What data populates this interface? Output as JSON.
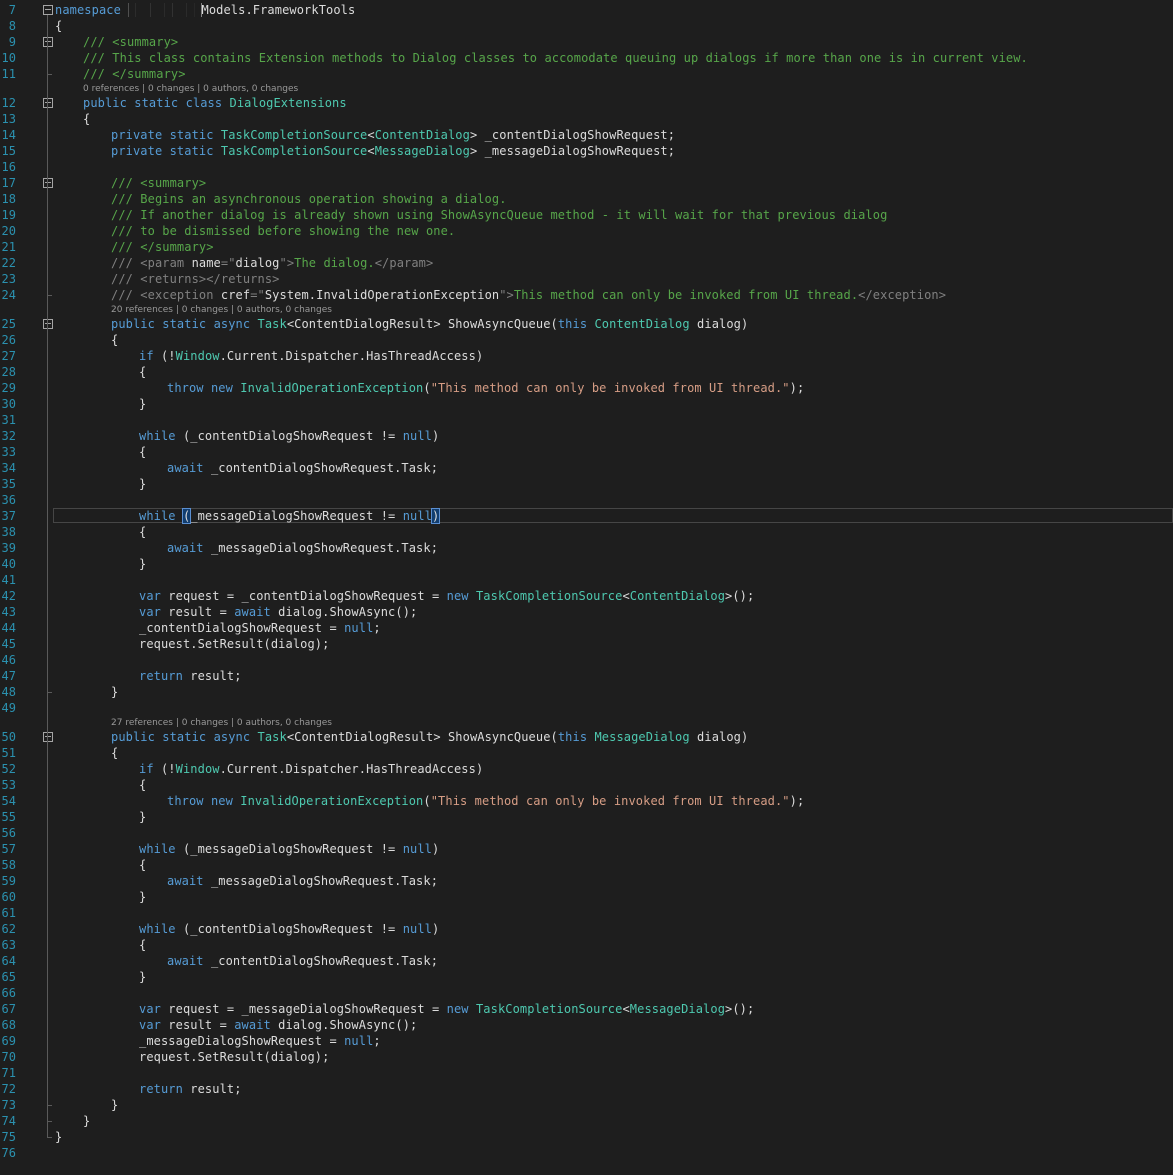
{
  "editor": {
    "theme": {
      "background": "#1e1e1e",
      "line_number_color": "#2b91af",
      "keyword_color": "#569cd6",
      "type_color": "#4ec9b0",
      "comment_color": "#57a64a",
      "string_color": "#d69d85",
      "text_color": "#dcdcdc"
    },
    "lines": [
      {
        "n": "7",
        "fold": true,
        "indent": 0,
        "tokens": [
          [
            "kw",
            "namespace"
          ],
          [
            "pl",
            " "
          ],
          [
            "red",
            "██████████"
          ],
          [
            "pl",
            "Models.FrameworkTools"
          ]
        ]
      },
      {
        "n": "8",
        "indent": 0,
        "tokens": [
          [
            "pl",
            "{"
          ]
        ]
      },
      {
        "n": "9",
        "fold": true,
        "indent": 1,
        "tokens": [
          [
            "cm",
            "/// <summary>"
          ]
        ]
      },
      {
        "n": "10",
        "indent": 1,
        "tokens": [
          [
            "cm",
            "/// This class contains Extension methods to Dialog classes to accomodate queuing up dialogs if more than one is in current view."
          ]
        ]
      },
      {
        "n": "11",
        "indent": 1,
        "tokens": [
          [
            "cm",
            "/// </summary>"
          ]
        ]
      },
      {
        "n": "12",
        "fold": true,
        "lens": "0 references | 0 changes | 0 authors, 0 changes",
        "indent": 1,
        "tokens": [
          [
            "kw",
            "public"
          ],
          [
            "pl",
            " "
          ],
          [
            "kw",
            "static"
          ],
          [
            "pl",
            " "
          ],
          [
            "kw",
            "class"
          ],
          [
            "pl",
            " "
          ],
          [
            "type",
            "DialogExtensions"
          ]
        ]
      },
      {
        "n": "13",
        "indent": 1,
        "tokens": [
          [
            "pl",
            "{"
          ]
        ]
      },
      {
        "n": "14",
        "indent": 2,
        "tokens": [
          [
            "kw",
            "private"
          ],
          [
            "pl",
            " "
          ],
          [
            "kw",
            "static"
          ],
          [
            "pl",
            " "
          ],
          [
            "type",
            "TaskCompletionSource"
          ],
          [
            "pl",
            "<"
          ],
          [
            "type",
            "ContentDialog"
          ],
          [
            "pl",
            "> _contentDialogShowRequest;"
          ]
        ]
      },
      {
        "n": "15",
        "indent": 2,
        "tokens": [
          [
            "kw",
            "private"
          ],
          [
            "pl",
            " "
          ],
          [
            "kw",
            "static"
          ],
          [
            "pl",
            " "
          ],
          [
            "type",
            "TaskCompletionSource"
          ],
          [
            "pl",
            "<"
          ],
          [
            "type",
            "MessageDialog"
          ],
          [
            "pl",
            "> _messageDialogShowRequest;"
          ]
        ]
      },
      {
        "n": "16",
        "indent": 0,
        "tokens": []
      },
      {
        "n": "17",
        "fold": true,
        "indent": 2,
        "tokens": [
          [
            "cm",
            "/// <summary>"
          ]
        ]
      },
      {
        "n": "18",
        "indent": 2,
        "tokens": [
          [
            "cm",
            "/// Begins an asynchronous operation showing a dialog."
          ]
        ]
      },
      {
        "n": "19",
        "indent": 2,
        "tokens": [
          [
            "cm",
            "/// If another dialog is already shown using ShowAsyncQueue method - it will wait for that previous dialog"
          ]
        ]
      },
      {
        "n": "20",
        "indent": 2,
        "tokens": [
          [
            "cm",
            "/// to be dismissed before showing the new one."
          ]
        ]
      },
      {
        "n": "21",
        "indent": 2,
        "tokens": [
          [
            "cm",
            "/// </summary>"
          ]
        ]
      },
      {
        "n": "22",
        "indent": 2,
        "tokens": [
          [
            "xml",
            "/// <param "
          ],
          [
            "pl",
            "name"
          ],
          [
            "xml",
            "=\""
          ],
          [
            "pl",
            "dialog"
          ],
          [
            "xml",
            "\">"
          ],
          [
            "cm",
            "The dialog."
          ],
          [
            "xml",
            "</param>"
          ]
        ]
      },
      {
        "n": "23",
        "indent": 2,
        "tokens": [
          [
            "xml",
            "/// <returns></returns>"
          ]
        ]
      },
      {
        "n": "24",
        "indent": 2,
        "tokens": [
          [
            "xml",
            "/// <exception "
          ],
          [
            "pl",
            "cref"
          ],
          [
            "xml",
            "=\""
          ],
          [
            "pl",
            "System.InvalidOperationException"
          ],
          [
            "xml",
            "\">"
          ],
          [
            "cm",
            "This method can only be invoked from UI thread."
          ],
          [
            "xml",
            "</exception>"
          ]
        ]
      },
      {
        "n": "25",
        "fold": true,
        "lens": "20 references | 0 changes | 0 authors, 0 changes",
        "indent": 2,
        "tokens": [
          [
            "kw",
            "public"
          ],
          [
            "pl",
            " "
          ],
          [
            "kw",
            "static"
          ],
          [
            "pl",
            " "
          ],
          [
            "kw",
            "async"
          ],
          [
            "pl",
            " "
          ],
          [
            "type",
            "Task"
          ],
          [
            "pl",
            "<ContentDialogResult> ShowAsyncQueue("
          ],
          [
            "kw",
            "this"
          ],
          [
            "pl",
            " "
          ],
          [
            "type",
            "ContentDialog"
          ],
          [
            "pl",
            " dialog)"
          ]
        ]
      },
      {
        "n": "26",
        "indent": 2,
        "tokens": [
          [
            "pl",
            "{"
          ]
        ]
      },
      {
        "n": "27",
        "indent": 3,
        "tokens": [
          [
            "kw",
            "if"
          ],
          [
            "pl",
            " (!"
          ],
          [
            "type",
            "Window"
          ],
          [
            "pl",
            ".Current.Dispatcher.HasThreadAccess)"
          ]
        ]
      },
      {
        "n": "28",
        "indent": 3,
        "tokens": [
          [
            "pl",
            "{"
          ]
        ]
      },
      {
        "n": "29",
        "indent": 4,
        "tokens": [
          [
            "kw",
            "throw"
          ],
          [
            "pl",
            " "
          ],
          [
            "kw",
            "new"
          ],
          [
            "pl",
            " "
          ],
          [
            "type",
            "InvalidOperationException"
          ],
          [
            "pl",
            "("
          ],
          [
            "str",
            "\"This method can only be invoked from UI thread.\""
          ],
          [
            "pl",
            ");"
          ]
        ]
      },
      {
        "n": "30",
        "indent": 3,
        "tokens": [
          [
            "pl",
            "}"
          ]
        ]
      },
      {
        "n": "31",
        "indent": 0,
        "tokens": []
      },
      {
        "n": "32",
        "indent": 3,
        "tokens": [
          [
            "kw",
            "while"
          ],
          [
            "pl",
            " (_contentDialogShowRequest != "
          ],
          [
            "kw",
            "null"
          ],
          [
            "pl",
            ")"
          ]
        ]
      },
      {
        "n": "33",
        "indent": 3,
        "tokens": [
          [
            "pl",
            "{"
          ]
        ]
      },
      {
        "n": "34",
        "indent": 4,
        "tokens": [
          [
            "kw",
            "await"
          ],
          [
            "pl",
            " _contentDialogShowRequest.Task;"
          ]
        ]
      },
      {
        "n": "35",
        "indent": 3,
        "tokens": [
          [
            "pl",
            "}"
          ]
        ]
      },
      {
        "n": "36",
        "indent": 0,
        "tokens": []
      },
      {
        "n": "37",
        "current": true,
        "indent": 3,
        "tokens": [
          [
            "kw",
            "while"
          ],
          [
            "pl",
            " "
          ],
          [
            "brk",
            "("
          ],
          [
            "pl",
            "_messageDialogShowRequest != "
          ],
          [
            "kw",
            "null"
          ],
          [
            "brk",
            ")"
          ]
        ]
      },
      {
        "n": "38",
        "indent": 3,
        "tokens": [
          [
            "pl",
            "{"
          ]
        ]
      },
      {
        "n": "39",
        "indent": 4,
        "tokens": [
          [
            "kw",
            "await"
          ],
          [
            "pl",
            " _messageDialogShowRequest.Task;"
          ]
        ]
      },
      {
        "n": "40",
        "indent": 3,
        "tokens": [
          [
            "pl",
            "}"
          ]
        ]
      },
      {
        "n": "41",
        "indent": 0,
        "tokens": []
      },
      {
        "n": "42",
        "indent": 3,
        "tokens": [
          [
            "kw",
            "var"
          ],
          [
            "pl",
            " request = _contentDialogShowRequest = "
          ],
          [
            "kw",
            "new"
          ],
          [
            "pl",
            " "
          ],
          [
            "type",
            "TaskCompletionSource"
          ],
          [
            "pl",
            "<"
          ],
          [
            "type",
            "ContentDialog"
          ],
          [
            "pl",
            ">();"
          ]
        ]
      },
      {
        "n": "43",
        "indent": 3,
        "tokens": [
          [
            "kw",
            "var"
          ],
          [
            "pl",
            " result = "
          ],
          [
            "kw",
            "await"
          ],
          [
            "pl",
            " dialog.ShowAsync();"
          ]
        ]
      },
      {
        "n": "44",
        "indent": 3,
        "tokens": [
          [
            "pl",
            "_contentDialogShowRequest = "
          ],
          [
            "kw",
            "null"
          ],
          [
            "pl",
            ";"
          ]
        ]
      },
      {
        "n": "45",
        "indent": 3,
        "tokens": [
          [
            "pl",
            "request.SetResult(dialog);"
          ]
        ]
      },
      {
        "n": "46",
        "indent": 0,
        "tokens": []
      },
      {
        "n": "47",
        "indent": 3,
        "tokens": [
          [
            "kw",
            "return"
          ],
          [
            "pl",
            " result;"
          ]
        ]
      },
      {
        "n": "48",
        "indent": 2,
        "tokens": [
          [
            "pl",
            "}"
          ]
        ]
      },
      {
        "n": "49",
        "indent": 0,
        "tokens": []
      },
      {
        "n": "50",
        "fold": true,
        "lens": "27 references | 0 changes | 0 authors, 0 changes",
        "indent": 2,
        "tokens": [
          [
            "kw",
            "public"
          ],
          [
            "pl",
            " "
          ],
          [
            "kw",
            "static"
          ],
          [
            "pl",
            " "
          ],
          [
            "kw",
            "async"
          ],
          [
            "pl",
            " "
          ],
          [
            "type",
            "Task"
          ],
          [
            "pl",
            "<ContentDialogResult> ShowAsyncQueue("
          ],
          [
            "kw",
            "this"
          ],
          [
            "pl",
            " "
          ],
          [
            "type",
            "MessageDialog"
          ],
          [
            "pl",
            " dialog)"
          ]
        ]
      },
      {
        "n": "51",
        "indent": 2,
        "tokens": [
          [
            "pl",
            "{"
          ]
        ]
      },
      {
        "n": "52",
        "indent": 3,
        "tokens": [
          [
            "kw",
            "if"
          ],
          [
            "pl",
            " (!"
          ],
          [
            "type",
            "Window"
          ],
          [
            "pl",
            ".Current.Dispatcher.HasThreadAccess)"
          ]
        ]
      },
      {
        "n": "53",
        "indent": 3,
        "tokens": [
          [
            "pl",
            "{"
          ]
        ]
      },
      {
        "n": "54",
        "indent": 4,
        "tokens": [
          [
            "kw",
            "throw"
          ],
          [
            "pl",
            " "
          ],
          [
            "kw",
            "new"
          ],
          [
            "pl",
            " "
          ],
          [
            "type",
            "InvalidOperationException"
          ],
          [
            "pl",
            "("
          ],
          [
            "str",
            "\"This method can only be invoked from UI thread.\""
          ],
          [
            "pl",
            ");"
          ]
        ]
      },
      {
        "n": "55",
        "indent": 3,
        "tokens": [
          [
            "pl",
            "}"
          ]
        ]
      },
      {
        "n": "56",
        "indent": 0,
        "tokens": []
      },
      {
        "n": "57",
        "indent": 3,
        "tokens": [
          [
            "kw",
            "while"
          ],
          [
            "pl",
            " (_messageDialogShowRequest != "
          ],
          [
            "kw",
            "null"
          ],
          [
            "pl",
            ")"
          ]
        ]
      },
      {
        "n": "58",
        "indent": 3,
        "tokens": [
          [
            "pl",
            "{"
          ]
        ]
      },
      {
        "n": "59",
        "indent": 4,
        "tokens": [
          [
            "kw",
            "await"
          ],
          [
            "pl",
            " _messageDialogShowRequest.Task;"
          ]
        ]
      },
      {
        "n": "60",
        "indent": 3,
        "tokens": [
          [
            "pl",
            "}"
          ]
        ]
      },
      {
        "n": "61",
        "indent": 0,
        "tokens": []
      },
      {
        "n": "62",
        "indent": 3,
        "tokens": [
          [
            "kw",
            "while"
          ],
          [
            "pl",
            " (_contentDialogShowRequest != "
          ],
          [
            "kw",
            "null"
          ],
          [
            "pl",
            ")"
          ]
        ]
      },
      {
        "n": "63",
        "indent": 3,
        "tokens": [
          [
            "pl",
            "{"
          ]
        ]
      },
      {
        "n": "64",
        "indent": 4,
        "tokens": [
          [
            "kw",
            "await"
          ],
          [
            "pl",
            " _contentDialogShowRequest.Task;"
          ]
        ]
      },
      {
        "n": "65",
        "indent": 3,
        "tokens": [
          [
            "pl",
            "}"
          ]
        ]
      },
      {
        "n": "66",
        "indent": 0,
        "tokens": []
      },
      {
        "n": "67",
        "indent": 3,
        "tokens": [
          [
            "kw",
            "var"
          ],
          [
            "pl",
            " request = _messageDialogShowRequest = "
          ],
          [
            "kw",
            "new"
          ],
          [
            "pl",
            " "
          ],
          [
            "type",
            "TaskCompletionSource"
          ],
          [
            "pl",
            "<"
          ],
          [
            "type",
            "MessageDialog"
          ],
          [
            "pl",
            ">();"
          ]
        ]
      },
      {
        "n": "68",
        "indent": 3,
        "tokens": [
          [
            "kw",
            "var"
          ],
          [
            "pl",
            " result = "
          ],
          [
            "kw",
            "await"
          ],
          [
            "pl",
            " dialog.ShowAsync();"
          ]
        ]
      },
      {
        "n": "69",
        "indent": 3,
        "tokens": [
          [
            "pl",
            "_messageDialogShowRequest = "
          ],
          [
            "kw",
            "null"
          ],
          [
            "pl",
            ";"
          ]
        ]
      },
      {
        "n": "70",
        "indent": 3,
        "tokens": [
          [
            "pl",
            "request.SetResult(dialog);"
          ]
        ]
      },
      {
        "n": "71",
        "indent": 0,
        "tokens": []
      },
      {
        "n": "72",
        "indent": 3,
        "tokens": [
          [
            "kw",
            "return"
          ],
          [
            "pl",
            " result;"
          ]
        ]
      },
      {
        "n": "73",
        "indent": 2,
        "tokens": [
          [
            "pl",
            "}"
          ]
        ]
      },
      {
        "n": "74",
        "indent": 1,
        "tokens": [
          [
            "pl",
            "}"
          ]
        ]
      },
      {
        "n": "75",
        "indent": 0,
        "tokens": [
          [
            "pl",
            "}"
          ]
        ]
      },
      {
        "n": "76",
        "indent": 0,
        "tokens": []
      }
    ]
  }
}
